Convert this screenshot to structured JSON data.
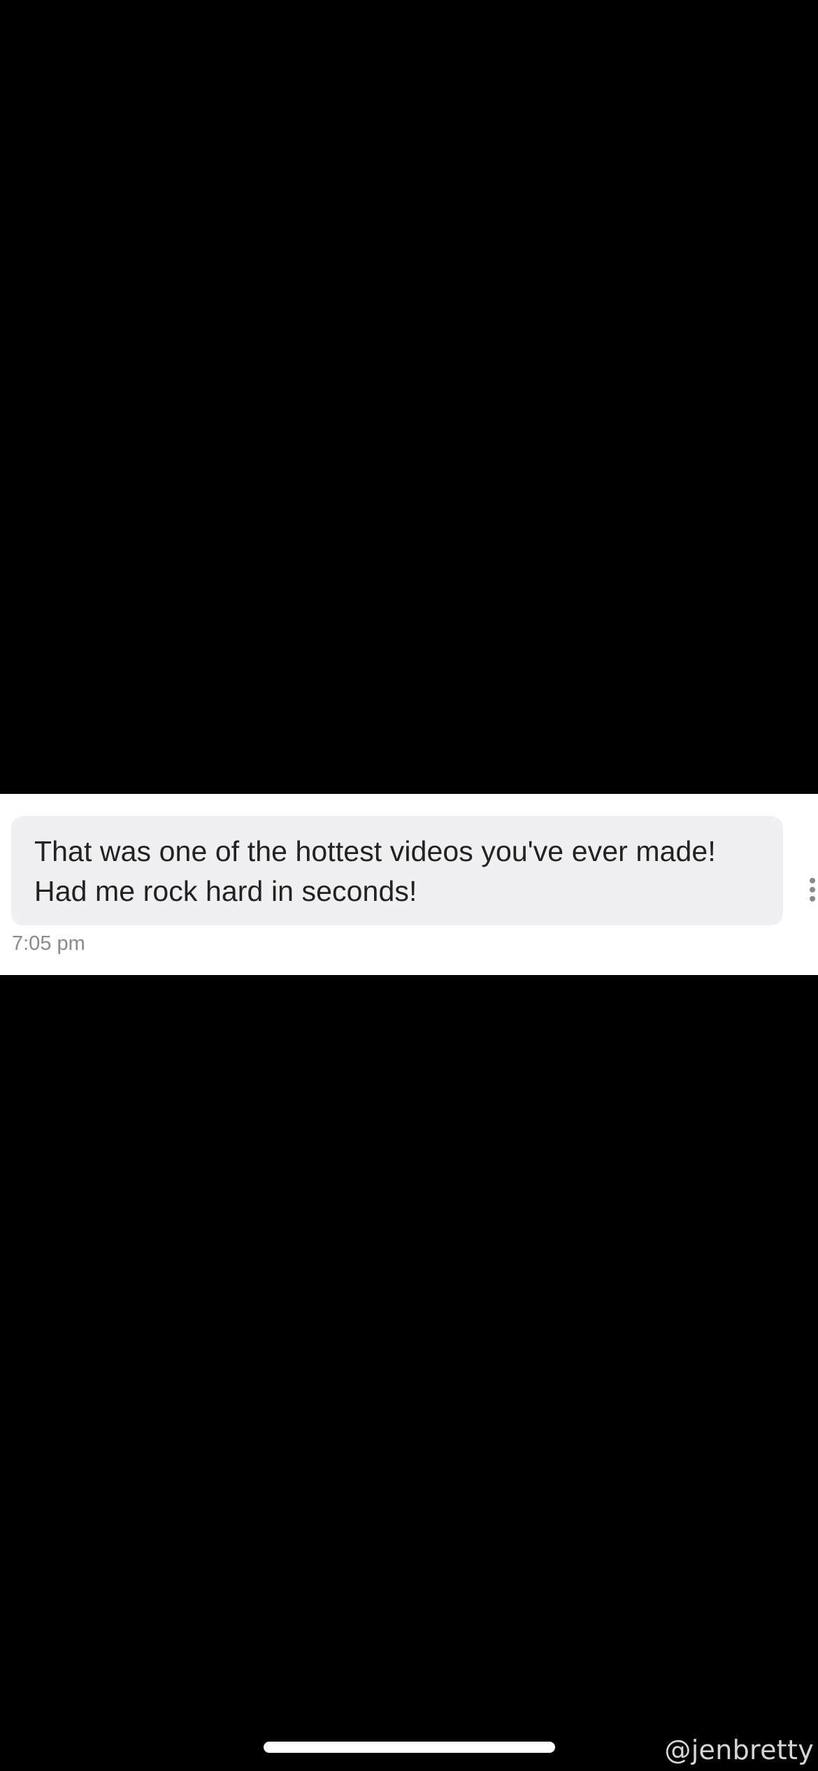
{
  "conversation": {
    "message": {
      "text": "That was one of the hottest videos you've ever made!\nHad me rock hard in seconds!",
      "time": "7:05 pm"
    },
    "more_icon": "more-vertical-icon"
  },
  "watermark": {
    "text": "@jenbretty"
  },
  "colors": {
    "background": "#000000",
    "message_panel": "#ffffff",
    "bubble": "#f0f0f2",
    "text": "#222222",
    "timestamp": "#8a8a8e"
  }
}
